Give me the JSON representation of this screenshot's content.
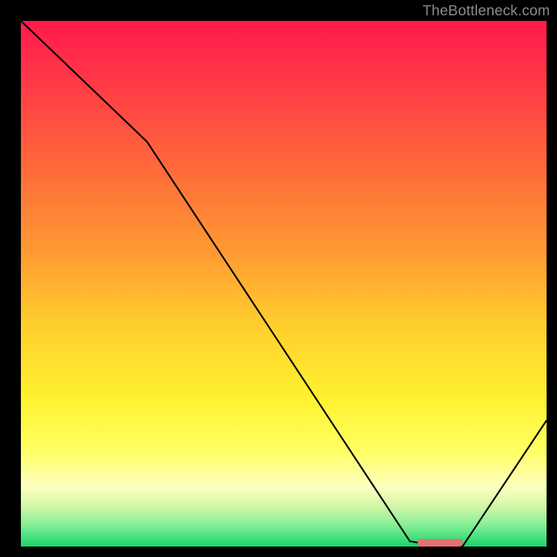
{
  "attribution": "TheBottleneck.com",
  "chart_data": {
    "type": "line",
    "title": "",
    "xlabel": "",
    "ylabel": "",
    "xlim": [
      0,
      100
    ],
    "ylim": [
      0,
      100
    ],
    "series": [
      {
        "name": "curve",
        "x": [
          0,
          24,
          74,
          80,
          84,
          100
        ],
        "y": [
          100,
          77,
          1,
          0,
          0,
          24
        ]
      }
    ],
    "marker": {
      "name": "highlight-bar",
      "x_start": 75.5,
      "x_end": 84,
      "y": 0.8,
      "color": "#e76f6f"
    },
    "gradient_stops": [
      {
        "offset": 0.0,
        "color": "#ff1a4b"
      },
      {
        "offset": 0.12,
        "color": "#ff3a46"
      },
      {
        "offset": 0.28,
        "color": "#ff6a3a"
      },
      {
        "offset": 0.44,
        "color": "#ff9a32"
      },
      {
        "offset": 0.58,
        "color": "#ffcf2d"
      },
      {
        "offset": 0.72,
        "color": "#fff22f"
      },
      {
        "offset": 0.82,
        "color": "#ffff66"
      },
      {
        "offset": 0.885,
        "color": "#ffffc0"
      },
      {
        "offset": 0.92,
        "color": "#d7f7a8"
      },
      {
        "offset": 0.955,
        "color": "#8ff09a"
      },
      {
        "offset": 1.0,
        "color": "#18d66a"
      }
    ],
    "colors": {
      "curve": "#000000",
      "frame": "#000000",
      "marker": "#e76f6f"
    }
  }
}
